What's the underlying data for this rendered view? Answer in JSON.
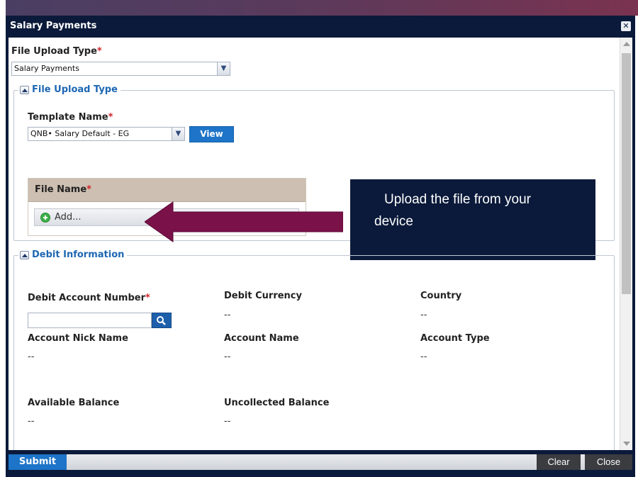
{
  "dialog": {
    "title": "Salary Payments"
  },
  "file_upload": {
    "type_label": "File Upload Type",
    "type_value": "Salary Payments",
    "section_title": "File Upload Type",
    "template_label": "Template Name",
    "template_value": "QNB•    Salary Default - EG",
    "view_button": "View",
    "file_name_label": "File Name",
    "add_button": "Add..."
  },
  "callout": {
    "line1": "Upload the file from your",
    "line2": "device"
  },
  "debit": {
    "section_title": "Debit Information",
    "account_number_label": "Debit Account Number",
    "currency_label": "Debit Currency",
    "currency_value": "--",
    "country_label": "Country",
    "country_value": "--",
    "nick_name_label": "Account Nick Name",
    "nick_name_value": "--",
    "account_name_label": "Account Name",
    "account_name_value": "--",
    "account_type_label": "Account Type",
    "account_type_value": "--",
    "available_label": "Available Balance",
    "available_value": "--",
    "uncollected_label": "Uncollected Balance",
    "uncollected_value": "--"
  },
  "required_marker": "*",
  "footer": {
    "submit": "Submit",
    "clear": "Clear",
    "close": "Close"
  },
  "icons": {
    "close": "close-icon",
    "search": "search-icon",
    "add": "add-icon",
    "collapse": "collapse-icon",
    "dropdown": "chevron-down-icon"
  },
  "colors": {
    "frame": "#0b1a3a",
    "accent_blue": "#1d74c8",
    "legend_blue": "#1e67b3",
    "required_red": "#d2242c",
    "arrow": "#7a1149",
    "file_header": "#cdbfb1"
  }
}
